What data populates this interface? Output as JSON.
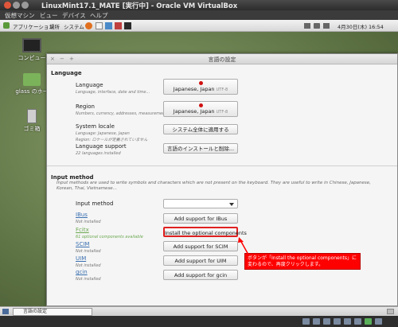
{
  "window": {
    "title": "LinuxMint17.1_MATE [実行中] - Oracle VM VirtualBox",
    "menu": [
      "仮想マシン",
      "ビュー",
      "デバイス",
      "ヘルプ"
    ]
  },
  "guest_panel": {
    "menus": [
      "アプリケーション",
      "場所",
      "システム"
    ],
    "clock": "4月30日(木) 16:54"
  },
  "desktop": {
    "icons": [
      {
        "label": "コンピュー",
        "icon": "computer-icon"
      },
      {
        "label": "glass のホー",
        "icon": "home-folder-icon"
      },
      {
        "label": "ゴミ箱",
        "icon": "trash-icon"
      }
    ]
  },
  "dialog": {
    "title": "言語の設定",
    "language_section": "Language",
    "rows": {
      "language": {
        "label": "Language",
        "desc": "Language, interface, date and time...",
        "value": "Japanese, Japan",
        "sub": "UTF-8"
      },
      "region": {
        "label": "Region",
        "desc": "Numbers, currency, addresses, measurement...",
        "value": "Japanese, Japan",
        "sub": "UTF-8"
      },
      "system_locale": {
        "label": "System locale",
        "desc1": "Language: Japanese, Japan",
        "desc2": "Region: ロケールが定義されていません",
        "button": "システム全体に適用する"
      },
      "language_support": {
        "label": "Language support",
        "desc": "22 languages installed",
        "button": "言語のインストールと削除..."
      }
    },
    "ime_section": "Input method",
    "ime_description": "Input methods are used to write symbols and characters which are not present on the keyboard. They are useful to write in Chinese, Japanese, Korean, Thai, Vietnamese...",
    "input_method_label": "Input method",
    "input_methods": [
      {
        "name": "IBus",
        "status": "Not installed",
        "button": "Add support for IBus"
      },
      {
        "name": "Fcitx",
        "status": "61 optional components available",
        "button": "Install the optional components"
      },
      {
        "name": "SCIM",
        "status": "Not installed",
        "button": "Add support for SCIM"
      },
      {
        "name": "UIM",
        "status": "Not installed",
        "button": "Add support for UIM"
      },
      {
        "name": "gcin",
        "status": "Not installed",
        "button": "Add support for gcin"
      }
    ]
  },
  "annotation": {
    "text": "ボタンが「Install the optional components」に変わるので、再度クリックします。"
  },
  "taskbar": {
    "item": "言語の設定"
  },
  "colors": {
    "highlight": "#e02020",
    "link": "#3a6fb0",
    "link_installed": "#6aa84f"
  }
}
